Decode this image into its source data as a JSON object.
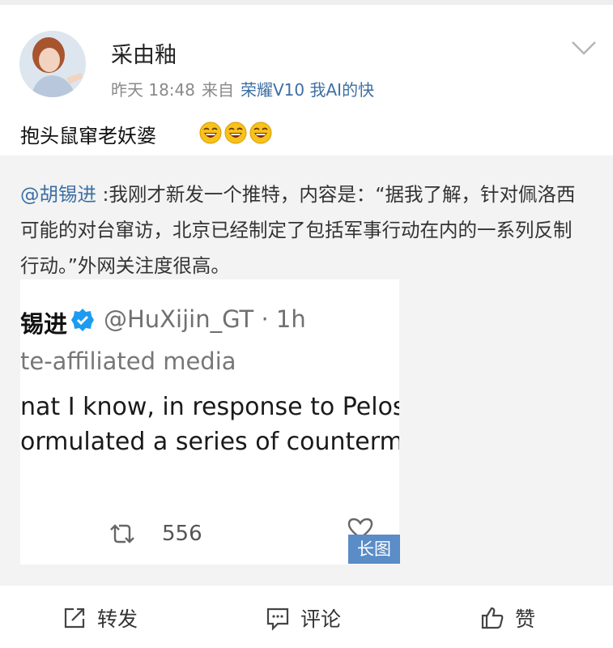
{
  "post": {
    "username": "采由釉",
    "time": "昨天 18:48",
    "from_label": "来自",
    "source": "荣耀V10 我AI的快",
    "text": "抱头鼠窜老妖婆",
    "emoji_icons": [
      "laughing-face-icon",
      "laughing-face-icon",
      "laughing-face-icon"
    ]
  },
  "repost": {
    "mention": "@胡锡进",
    "text": " :我刚才新发一个推特，内容是：“据我了解，针对佩洛西可能的对台窜访，北京已经制定了包括军事行动在内的一系列反制行动。”外网关注度很高。"
  },
  "tweet_image": {
    "name_fragment": "锡进",
    "handle_time": "@HuXijin_GT · 1h",
    "affiliation": "te-affiliated media",
    "line1": "nat I know, in response to Pelosi'",
    "line2": "ormulated a series of counterme",
    "retweet_count": "556",
    "badge": "长图"
  },
  "actions": {
    "repost": "转发",
    "comment": "评论",
    "like": "赞"
  },
  "colors": {
    "link": "#3d6fa3",
    "badge": "#5a8cc8",
    "verified": "#1d9bf0"
  }
}
